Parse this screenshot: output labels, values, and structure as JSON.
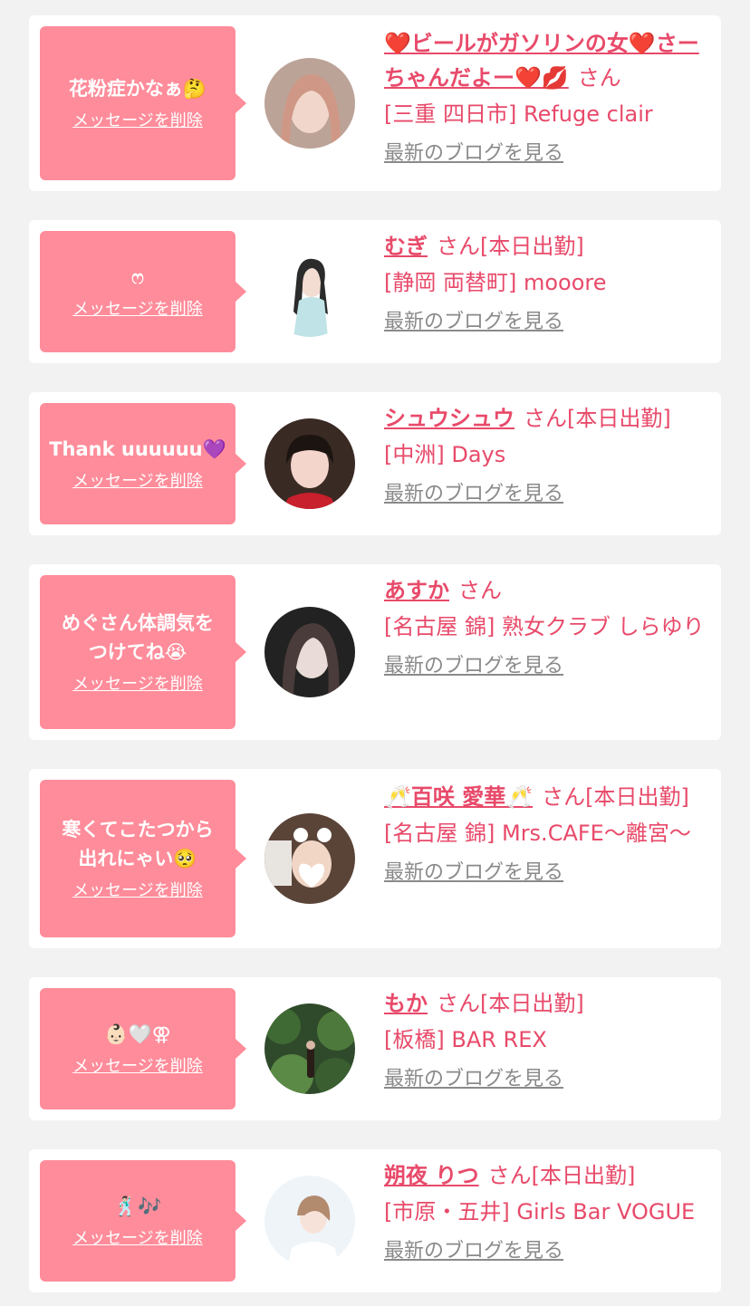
{
  "delete_label": "メッセージを削除",
  "blog_label": "最新のブログを見る",
  "colors": {
    "bubble": "#ff8c9a",
    "name": "#e84a6a",
    "link_gray": "#8a8a8a",
    "background": "#f2f2f2"
  },
  "entries": [
    {
      "message": "花粉症かなぁ🤔",
      "name": "❤️ビールがガソリンの女❤️さーちゃんだよー❤️💋",
      "suffix": "さん",
      "location": "[三重 四日市] Refuge clair",
      "avatar": "woman-portrait"
    },
    {
      "message": "ෆ",
      "name": "むぎ",
      "suffix": "さん[本日出勤]",
      "location": "[静岡 両替町] mooore",
      "avatar": "woman-portrait"
    },
    {
      "message": "Thank uuuuuu💜",
      "name": "シュウシュウ",
      "suffix": "さん[本日出勤]",
      "location": "[中洲] Days",
      "avatar": "woman-portrait"
    },
    {
      "message": "めぐさん体調気を\nつけてね😭",
      "name": "あすか",
      "suffix": "さん",
      "location": "[名古屋 錦] 熟女クラブ しらゆり",
      "avatar": "woman-portrait"
    },
    {
      "message": "寒くてこたつから\n出れにゃい🥺",
      "name": "🥂百咲 愛華🥂",
      "suffix": "さん[本日出勤]",
      "location": "[名古屋 錦] Mrs.CAFE〜離宮〜",
      "avatar": "woman-portrait"
    },
    {
      "message": "👶🏻🤍⚢",
      "name": "もか",
      "suffix": "さん[本日出勤]",
      "location": "[板橋] BAR REX",
      "avatar": "woman-in-garden"
    },
    {
      "message": "🕺🏻🎶",
      "name": "朔夜 りつ",
      "suffix": "さん[本日出勤]",
      "location": "[市原・五井] Girls Bar VOGUE",
      "avatar": "woman-portrait"
    }
  ]
}
